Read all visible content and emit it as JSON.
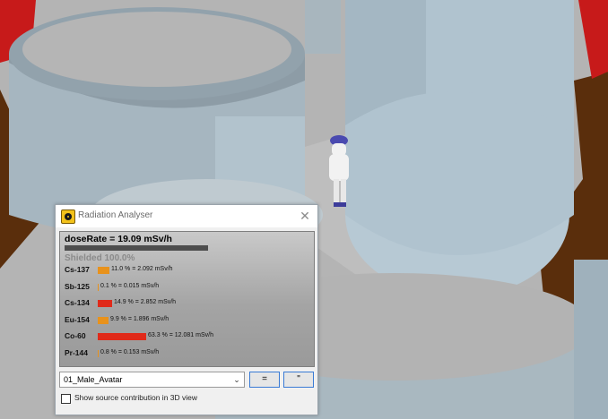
{
  "window": {
    "title": "Radiation Analyser",
    "close_glyph": "✕"
  },
  "summary": {
    "dose_rate": "doseRate = 19.09 mSv/h",
    "shielded": "Shielded  100.0%"
  },
  "isotopes": [
    {
      "name": "Cs-137",
      "text": "11.0 % = 2.092 mSv/h",
      "percent": 11.0,
      "color": "#e8921c"
    },
    {
      "name": "Sb-125",
      "text": "0.1 % = 0.015 mSv/h",
      "percent": 0.1,
      "color": "#e8921c"
    },
    {
      "name": "Cs-134",
      "text": "14.9 % = 2.852 mSv/h",
      "percent": 14.9,
      "color": "#e02a1a"
    },
    {
      "name": "Eu-154",
      "text": "9.9 % = 1.896 mSv/h",
      "percent": 9.9,
      "color": "#e8921c"
    },
    {
      "name": "Co-60",
      "text": "63.3 % = 12.081 mSv/h",
      "percent": 63.3,
      "color": "#e02a1a"
    },
    {
      "name": "Pr-144",
      "text": "0.8 % = 0.153 mSv/h",
      "percent": 0.8,
      "color": "#e8921c"
    }
  ],
  "controls": {
    "avatar_select": "01_Male_Avatar",
    "btn_equals": "=",
    "btn_quote": "\""
  },
  "option": {
    "show_source_label": "Show source contribution in 3D view",
    "checked": false
  },
  "colors": {
    "bar_orange": "#e8921c",
    "bar_red": "#e02a1a",
    "button_border": "#3a7bd5"
  }
}
